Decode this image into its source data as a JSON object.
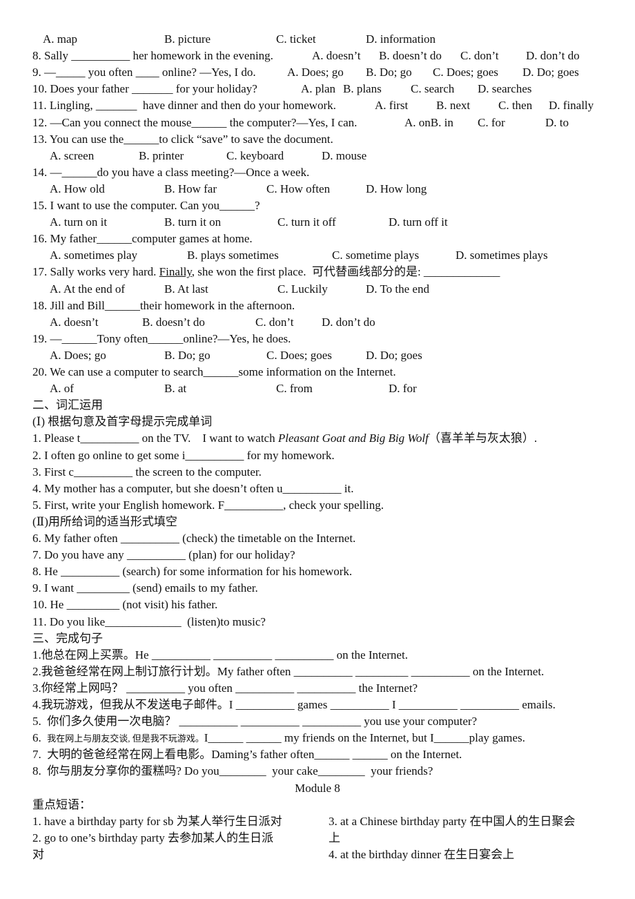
{
  "lines": [
    [
      [
        "A. map"
      ],
      [
        "B. picture"
      ],
      [
        "C. ticket"
      ],
      [
        "D. information"
      ]
    ],
    [
      [
        "8. Sally __________ her homework in the evening."
      ],
      [
        "A. doesn’t"
      ],
      [
        "B. doesn’t do"
      ],
      [
        "C. don’t"
      ],
      [
        "D. don’t do"
      ]
    ],
    [
      [
        "9. —_____ you often ____ online? —Yes, I do."
      ],
      [
        "A. Does; go"
      ],
      [
        "B. Do; go"
      ],
      [
        "C. Does; goes"
      ],
      [
        "D. Do; goes"
      ]
    ],
    [
      [
        "10. Does your father _______ for your holiday?"
      ],
      [
        "A. plan"
      ],
      [
        "B. plans"
      ],
      [
        "C. search"
      ],
      [
        "D. searches"
      ]
    ],
    [
      [
        "11. Lingling, _______  have dinner and then do your homework."
      ],
      [
        "A. first"
      ],
      [
        "B. next"
      ],
      [
        "C. then"
      ],
      [
        "D. finally"
      ]
    ],
    [
      [
        "12. —Can you connect the mouse______ the computer?—Yes, I can."
      ],
      [
        "A. onB. in"
      ],
      [
        "C. for"
      ],
      [
        "D. to"
      ]
    ],
    [
      [
        "13. You can use the______to click “save” to save the document."
      ]
    ],
    [
      [
        "A. screen"
      ],
      [
        "B. printer"
      ],
      [
        "C. keyboard"
      ],
      [
        "D. mouse"
      ]
    ],
    [
      [
        "14. —______do you have a class meeting?—Once a week."
      ]
    ],
    [
      [
        "A. How old"
      ],
      [
        "B. How far"
      ],
      [
        "C. How often"
      ],
      [
        "D. How long"
      ]
    ],
    [
      [
        "15. I want to use the computer. Can you______?"
      ]
    ],
    [
      [
        "A. turn on it"
      ],
      [
        "B. turn it on"
      ],
      [
        "C. turn it off"
      ],
      [
        "D. turn off it"
      ]
    ],
    [
      [
        "16. My father______computer games at home."
      ]
    ],
    [
      [
        "A. sometimes play"
      ],
      [
        "B. plays sometimes"
      ],
      [
        "C. sometime plays"
      ],
      [
        "D. sometimes plays"
      ]
    ],
    [
      [
        "17. Sally works very hard. ",
        "Finally",
        ", she won the first place.  可代替画线部分的是: _____________"
      ]
    ],
    [
      [
        "A. At the end of"
      ],
      [
        "B. At last"
      ],
      [
        "C. Luckily"
      ],
      [
        "D. To the end"
      ]
    ],
    [
      [
        "18. Jill and Bill______their homework in the afternoon."
      ]
    ],
    [
      [
        "A. doesn’t"
      ],
      [
        "B. doesn’t do"
      ],
      [
        "C. don’t"
      ],
      [
        "D. don’t do"
      ]
    ],
    [
      [
        "19. —______Tony often______online?—Yes, he does."
      ]
    ],
    [
      [
        "A. Does; go"
      ],
      [
        "B. Do; go"
      ],
      [
        "C. Does; goes"
      ],
      [
        "D. Do; goes"
      ]
    ],
    [
      [
        "20. We can use a computer to search______some information on the Internet."
      ]
    ],
    [
      [
        "A. of"
      ],
      [
        "B. at"
      ],
      [
        "C. from"
      ],
      [
        "D. for"
      ]
    ],
    [
      [
        "二、词汇运用"
      ]
    ],
    [
      [
        "(Ⅰ) 根据句意及首字母提示完成单词"
      ]
    ],
    [
      [
        "1. Please t__________ on the TV.    I want to watch ",
        "Pleasant Goat and Big Big Wolf",
        "（喜羊羊与灰太狼）."
      ]
    ],
    [
      [
        "2. I often go online to get some i__________ for my homework."
      ]
    ],
    [
      [
        "3. First c__________ the screen to the computer."
      ]
    ],
    [
      [
        "4. My mother has a computer, but she doesn’t often u__________ it."
      ]
    ],
    [
      [
        "5. First, write your English homework. F__________, check your spelling."
      ]
    ],
    [
      [
        "(Ⅱ)用所给词的适当形式填空"
      ]
    ],
    [
      [
        "6. My father often __________ (check) the timetable on the Internet."
      ]
    ],
    [
      [
        "7. Do you have any __________ (plan) for our holiday?"
      ]
    ],
    [
      [
        "8. He __________ (search) for some information for his homework."
      ]
    ],
    [
      [
        "9. I want _________ (send) emails to my father."
      ]
    ],
    [
      [
        "10. He _________ (not visit) his father."
      ]
    ],
    [
      [
        "11. Do you like_____________  (listen)to music?"
      ]
    ],
    [
      [
        "三、完成句子"
      ]
    ],
    [
      [
        "1.他总在网上买票。He __________ __________ __________ on the Internet."
      ]
    ],
    [
      [
        "2.我爸爸经常在网上制订旅行计划。My father often __________ _________ __________ on the Internet."
      ]
    ],
    [
      [
        "3.你经常上网吗？ __________ you often __________ __________ the Internet?"
      ]
    ],
    [
      [
        "4.我玩游戏，但我从不发送电子邮件。I __________ games __________ I __________ __________ emails."
      ]
    ],
    [
      [
        "5.  你们多久使用一次电脑？ __________ __________ __________ you use your computer?"
      ]
    ],
    [
      [
        "6.  ",
        "我在网上与朋友交谈, 但是我不玩游戏。",
        "I______ ______ my friends on the Internet, but I______play games."
      ]
    ],
    [
      [
        "7.  大明的爸爸经常在网上看电影。Daming’s father often______ ______ on the Internet."
      ]
    ],
    [
      [
        "8.  你与朋友分享你的蛋糕吗? Do you________  your cake________  your friends?"
      ]
    ],
    [
      [
        "Module 8"
      ]
    ],
    [
      [
        "重点短语："
      ]
    ],
    [
      [
        "1. have a birthday party for sb 为某人举行生日派对"
      ],
      [
        "3. at a Chinese birthday party 在中国人的生日聚会"
      ]
    ],
    [
      [
        "2. go to one’s birthday party 去参加某人的生日派"
      ],
      [
        "上"
      ]
    ],
    [
      [
        "对"
      ],
      [
        "4. at the birthday dinner 在生日宴会上"
      ]
    ]
  ]
}
